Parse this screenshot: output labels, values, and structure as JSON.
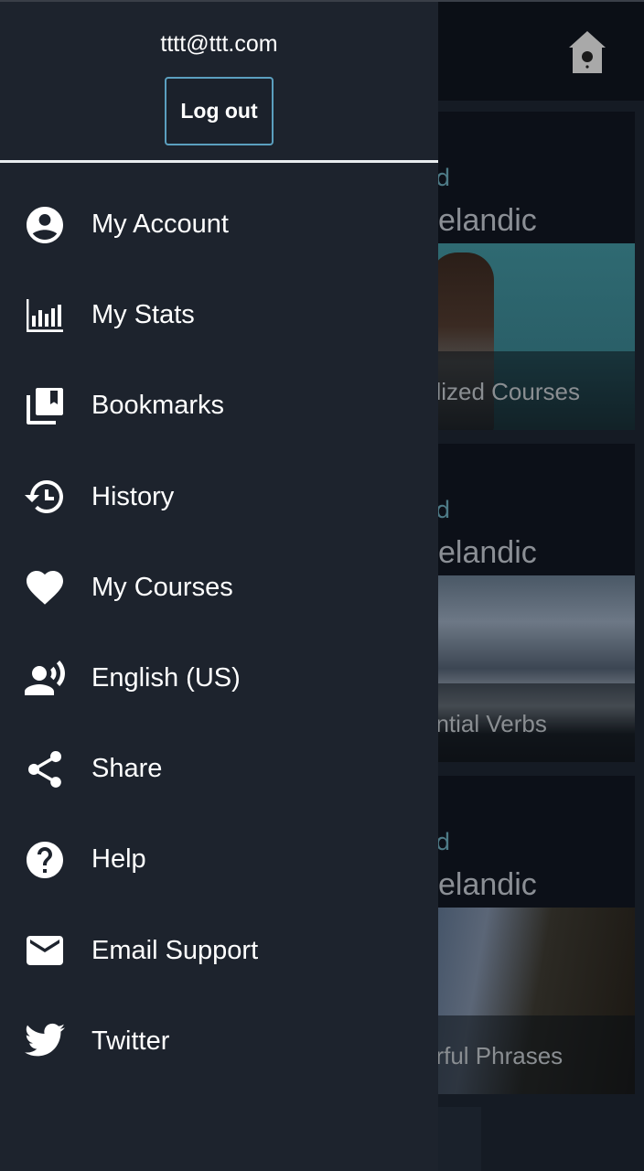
{
  "drawer": {
    "user_email": "tttt@ttt.com",
    "logout_label": "Log out",
    "items": [
      {
        "id": "my-account",
        "label": "My Account",
        "icon": "account-circle-icon"
      },
      {
        "id": "my-stats",
        "label": "My Stats",
        "icon": "bar-chart-icon"
      },
      {
        "id": "bookmarks",
        "label": "Bookmarks",
        "icon": "bookmarks-icon"
      },
      {
        "id": "history",
        "label": "History",
        "icon": "history-icon"
      },
      {
        "id": "my-courses",
        "label": "My Courses",
        "icon": "heart-icon"
      },
      {
        "id": "language",
        "label": "English (US)",
        "icon": "voice-person-icon"
      },
      {
        "id": "share",
        "label": "Share",
        "icon": "share-icon"
      },
      {
        "id": "help",
        "label": "Help",
        "icon": "help-circle-icon"
      },
      {
        "id": "email-support",
        "label": "Email Support",
        "icon": "mail-icon"
      },
      {
        "id": "twitter",
        "label": "Twitter",
        "icon": "twitter-icon"
      }
    ]
  },
  "background": {
    "header_icon": "birdhouse-home-icon",
    "cards": [
      {
        "kicker": "d",
        "title": "celandic",
        "subtitle": "alized Courses"
      },
      {
        "kicker": "d",
        "title": "celandic",
        "subtitle": "ential Verbs"
      },
      {
        "kicker": "d",
        "title": "celandic",
        "subtitle": "erful Phrases"
      }
    ]
  },
  "colors": {
    "drawer_bg": "#1d232d",
    "logout_border": "#5b9fbf",
    "text": "#ffffff",
    "kicker": "#4d7a86"
  }
}
